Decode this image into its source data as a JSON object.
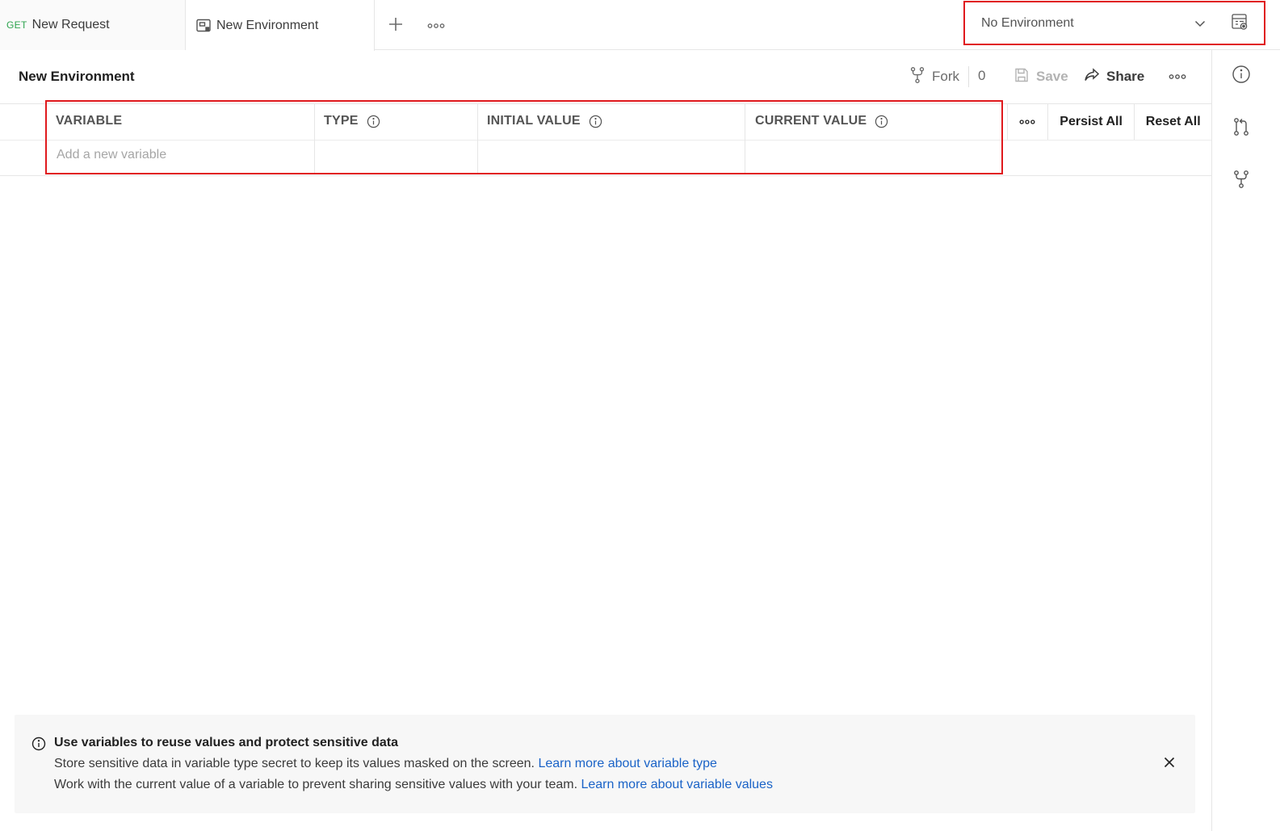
{
  "tabs": {
    "request": {
      "method": "GET",
      "label": "New Request"
    },
    "environment": {
      "label": "New Environment"
    }
  },
  "environment_selector": {
    "selected": "No Environment"
  },
  "header": {
    "title": "New Environment",
    "fork_label": "Fork",
    "fork_count": "0",
    "save_label": "Save",
    "share_label": "Share"
  },
  "table": {
    "columns": {
      "variable": "VARIABLE",
      "type": "TYPE",
      "initial_value": "INITIAL VALUE",
      "current_value": "CURRENT VALUE"
    },
    "new_variable_placeholder": "Add a new variable",
    "persist_all_label": "Persist All",
    "reset_all_label": "Reset All"
  },
  "banner": {
    "title": "Use variables to reuse values and protect sensitive data",
    "line1_text": "Store sensitive data in variable type secret to keep its values masked on the screen.",
    "line1_link": "Learn more about variable type",
    "line2_text": "Work with the current value of a variable to prevent sharing sensitive values with your team.",
    "line2_link": "Learn more about variable values"
  },
  "colors": {
    "method_get": "#2ea44f",
    "highlight_border": "#e0191d",
    "link": "#1a63c7"
  },
  "icons": [
    "environment-icon",
    "plus-icon",
    "more-icon",
    "chevron-down-icon",
    "environment-quick-look-icon",
    "fork-icon",
    "save-icon",
    "share-icon",
    "info-icon",
    "pull-request-icon",
    "close-icon"
  ]
}
